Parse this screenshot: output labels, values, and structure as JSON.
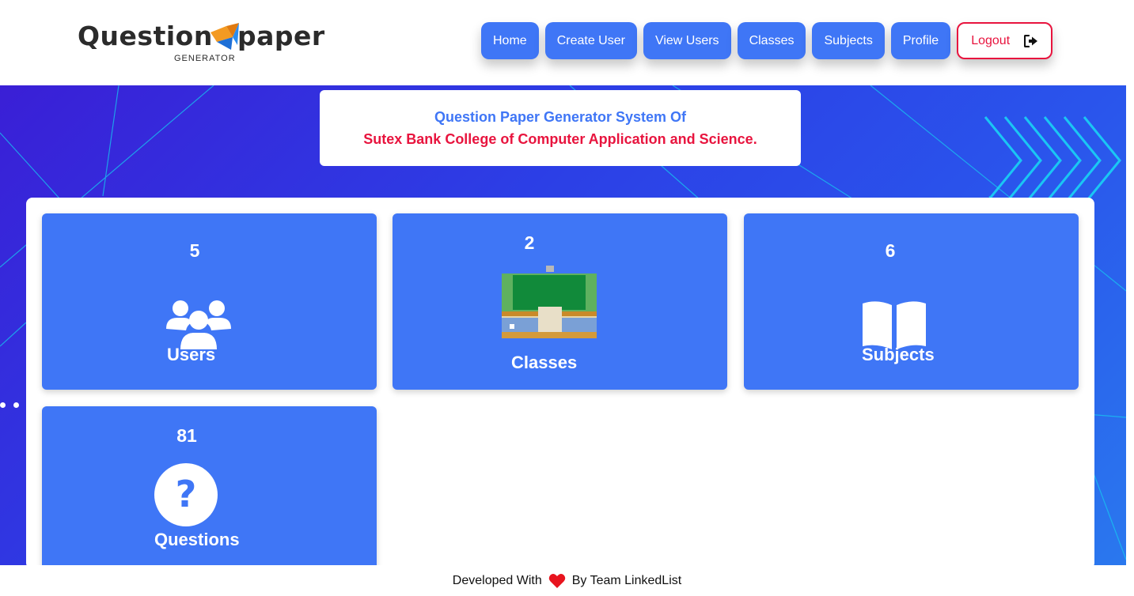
{
  "logo": {
    "word1": "Question",
    "word2": "paper",
    "subtitle": "GENERATOR",
    "icon": "paper-plane-icon"
  },
  "nav": {
    "home": "Home",
    "create_user": "Create User",
    "view_users": "View Users",
    "classes": "Classes",
    "subjects": "Subjects",
    "profile": "Profile",
    "logout": "Logout",
    "logout_icon": "sign-out-icon"
  },
  "banner": {
    "line1": "Question Paper Generator System Of",
    "line2": "Sutex Bank College of Computer Application and Science."
  },
  "cards": {
    "users": {
      "count": "5",
      "label": "Users",
      "icon": "users-icon"
    },
    "classes": {
      "count": "2",
      "label": "Classes",
      "icon": "classroom-icon"
    },
    "subjects": {
      "count": "6",
      "label": "Subjects",
      "icon": "open-book-icon"
    },
    "questions": {
      "count": "81",
      "label": "Questions",
      "icon": "question-circle-icon"
    }
  },
  "footer": {
    "prefix": "Developed With",
    "suffix": "By Team LinkedList",
    "icon": "heart-icon"
  },
  "colors": {
    "primary": "#3f76f6",
    "danger": "#e8143e",
    "hero_gradient_start": "#3a1fd6",
    "hero_gradient_end": "#2a78ee",
    "accent_line": "#16c8f0"
  }
}
